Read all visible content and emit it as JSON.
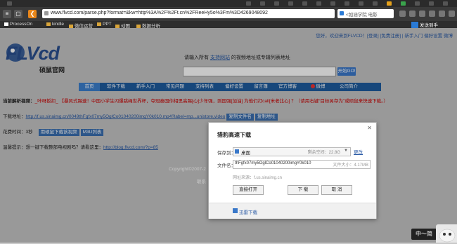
{
  "browser": {
    "url": "www.flvcd.com/parse.php?format=&kw=http%3A%2F%2Ft.cn%2FReeHy5o%3Fm%3D4269048092",
    "search_placeholder": "<如涵学院 电影",
    "device_label": "发送到手",
    "bookmarks": [
      "ProcessOn",
      "kindle",
      "微信运营",
      "PPT",
      "动图",
      "数据分析"
    ]
  },
  "page": {
    "login_links": "您好，欢迎来到FLVCD！[登录] [免费注册] | 新手入门  偏好设置  微博",
    "logo_text": "FLVcd",
    "logo_subtitle": "硕鼠官网",
    "subtitle_prefix": "请输入所有",
    "subtitle_link": "支持网站",
    "subtitle_suffix": "的视频地址或专辑列表地址",
    "parse_button": "开始GO!",
    "nav": [
      "首页",
      "软件下载",
      "新手入门",
      "常见问题",
      "支持列表",
      "偏好设置",
      "留言簿",
      "官方博客",
      "微博",
      "公司简介"
    ],
    "now_parse_label": "当前解析视频：",
    "now_parse_title": "_咔呀扳扣_ 【暴风式踢速！中国小学生闪爆跳绳世界杯，夺冠秦国你相思高踢[心]少年强，则国强[加油] 为他们打call[米老比心] ？（请用右键“目标另存为”或硕鼠来快速下载。）",
    "download_label": "下载地址：",
    "download_link": "http://f.us.sinaimg.cn/0049thFgfx07my5OglCo01040200imgY0k010.mp4?label=mp...unistore,video",
    "copy_filename": "复制文件名",
    "copy_link": "复制地址",
    "time_label": "花费时间：",
    "time_value": "3秒",
    "btn_download_video": "用硕鼠下载该视频",
    "btn_m3u": "M3U列表",
    "tip_label": "温馨提示：",
    "tip_text": "想一键下载整部电视剧吗？请看这里：",
    "tip_link": "http://blog.flvcd.com/?p=85",
    "footer_line1": "Copyright©2007-2",
    "footer_line2": "联系"
  },
  "dialog": {
    "title": "猎豹高速下载",
    "save_label": "保存到：",
    "save_folder": "桌面",
    "free_space": "剩余空间：22.8G",
    "change_button": "更改",
    "file_label": "文件名：",
    "file_name": "thFgfx07my5OglCo01040200imgY0k010",
    "file_size": "文件大小：4.17MB",
    "source": "网址来源：f.us.sinaimg.cn",
    "open_button": "直接打开",
    "download_button": "下 载",
    "cancel_button": "取 消",
    "footer_text": "迅雷下载"
  },
  "ime": {
    "label": "中〜简"
  }
}
